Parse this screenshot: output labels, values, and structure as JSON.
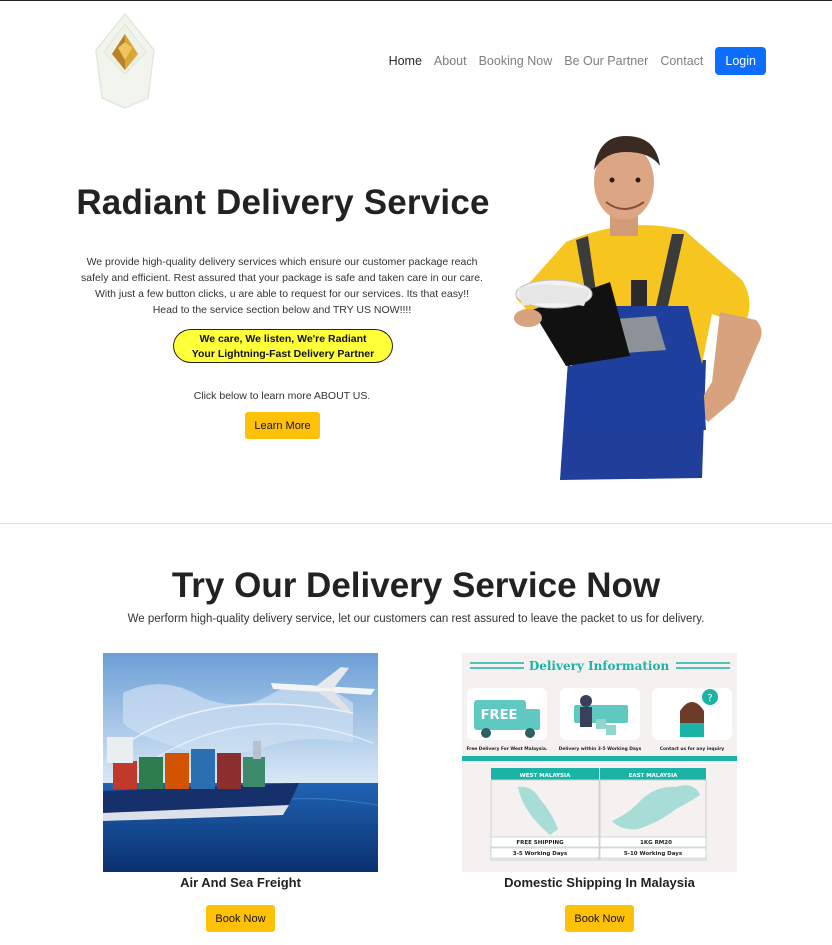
{
  "nav": {
    "links": [
      "Home",
      "About",
      "Booking Now",
      "Be Our Partner",
      "Contact"
    ],
    "login_label": "Login"
  },
  "hero": {
    "title": "Radiant Delivery Service",
    "description_lines": [
      "We provide high-quality delivery services which ensure our customer package reach",
      "safely and efficient. Rest assured that your package is safe and taken care in our care.",
      "With just a few button clicks, u are able to request for our services. Its that easy!!",
      "Head to the service section below and TRY US NOW!!!!"
    ],
    "tagline_line1": "We care, We listen, We're Radiant",
    "tagline_line2": "Your Lightning-Fast Delivery Partner",
    "click_text": "Click below to learn more ABOUT US.",
    "learn_more_label": "Learn More"
  },
  "services": {
    "title": "Try Our Delivery Service Now",
    "subtitle": "We perform high-quality delivery service, let our customers can rest assured to leave the packet to us for delivery.",
    "cards": [
      {
        "title": "Air And Sea Freight",
        "button": "Book Now"
      },
      {
        "title": "Domestic Shipping In Malaysia",
        "button": "Book Now"
      }
    ],
    "info_graphic": {
      "heading": "Delivery Information",
      "free_label": "FREE",
      "captions": [
        "Free Delivery For West Malaysia.",
        "Delivery within 3-5 Working Days",
        "Contact us for any inquiry"
      ],
      "west_label": "WEST MALAYSIA",
      "east_label": "EAST MALAYSIA",
      "west_price": "FREE SHIPPING",
      "west_days": "3-5 Working Days",
      "east_price": "1KG RM20",
      "east_days": "5-10 Working Days"
    }
  },
  "colors": {
    "primary": "#0d6efd",
    "warning": "#ffc107",
    "tagline_bg": "#ffff3a",
    "teal": "#1ab3a6"
  }
}
